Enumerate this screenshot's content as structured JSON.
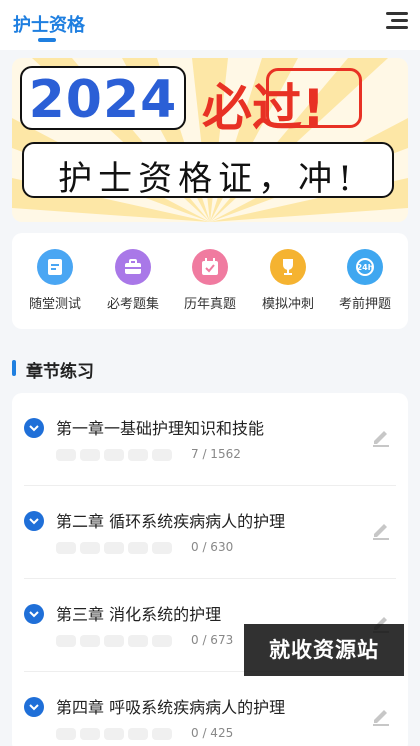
{
  "header": {
    "title": "护士资格",
    "menu_icon": "menu-icon"
  },
  "banner": {
    "year": "2024",
    "headline": "必过!",
    "slogan": "护士资格证，冲!"
  },
  "quick_links": [
    {
      "label": "随堂测试",
      "icon": "note-icon",
      "color": "#4aa6f3"
    },
    {
      "label": "必考题集",
      "icon": "briefcase-icon",
      "color": "#a978e8"
    },
    {
      "label": "历年真题",
      "icon": "calendar-icon",
      "color": "#f07ba0"
    },
    {
      "label": "模拟冲刺",
      "icon": "trophy-icon",
      "color": "#f5b331"
    },
    {
      "label": "考前押题",
      "icon": "24h-icon",
      "color": "#3fa7f0"
    }
  ],
  "section": {
    "title": "章节练习"
  },
  "chapters": [
    {
      "title": "第一章一基础护理知识和技能",
      "count": "7 / 1562"
    },
    {
      "title": "第二章  循环系统疾病病人的护理",
      "count": "0 / 630"
    },
    {
      "title": "第三章 消化系统的护理",
      "count": "0 / 673"
    },
    {
      "title": "第四章 呼吸系统疾病病人的护理",
      "count": "0 / 425"
    }
  ],
  "watermark": "就收资源站",
  "colors": {
    "accent": "#1f7fe0",
    "red": "#e83124",
    "year_blue": "#2b5fd6"
  }
}
